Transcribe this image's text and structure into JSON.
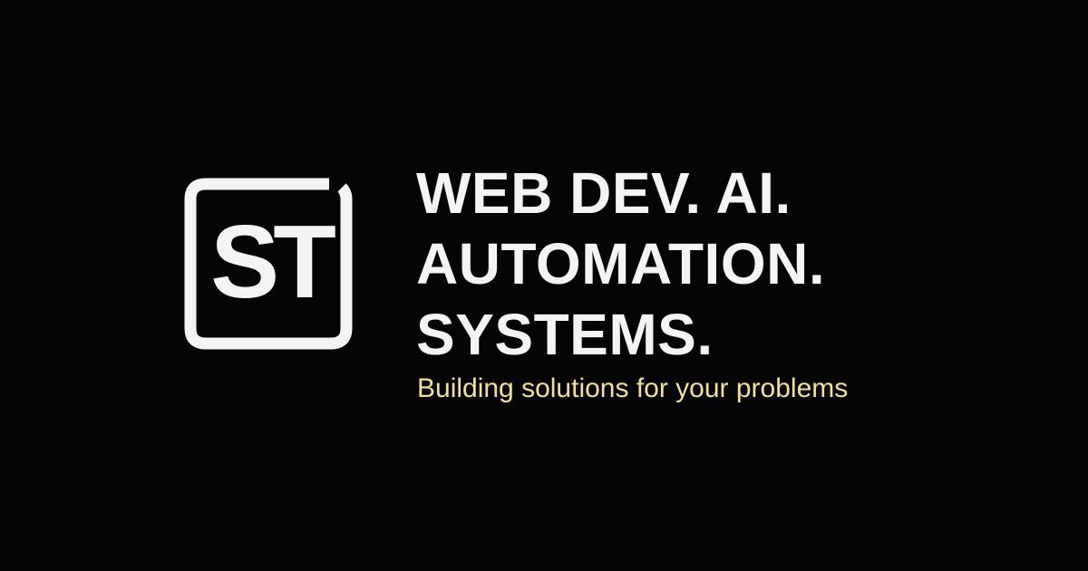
{
  "logo": {
    "monogram": "ST",
    "color": "#f4f4f4"
  },
  "headline": {
    "lines": [
      "WEB DEV. AI.",
      "AUTOMATION.",
      "SYSTEMS."
    ],
    "color": "#f4f4f4"
  },
  "tagline": {
    "text": "Building solutions for your problems",
    "color": "#f0e0a0"
  },
  "background": "#050505"
}
